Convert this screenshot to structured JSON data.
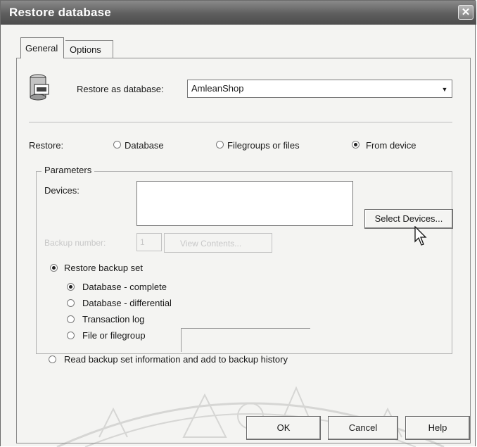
{
  "window": {
    "title": "Restore database",
    "close_glyph": "✕"
  },
  "tabs": [
    {
      "label": "General"
    },
    {
      "label": "Options"
    }
  ],
  "restore_as": {
    "label": "Restore as database:",
    "value": "AmleanShop",
    "arrow": "▼"
  },
  "restore_mode": {
    "label": "Restore:",
    "options": [
      {
        "label": "Database",
        "checked": false
      },
      {
        "label": "Filegroups or files",
        "checked": false
      },
      {
        "label": "From device",
        "checked": true
      }
    ]
  },
  "parameters": {
    "label": "Parameters",
    "devices_label": "Devices:",
    "select_devices_label": "Select Devices...",
    "backup_number_label": "Backup number:",
    "backup_number_value": "1",
    "view_contents_label": "View Contents...",
    "restore_backup_set": {
      "label": "Restore backup set",
      "checked": true
    },
    "backup_types": [
      {
        "label": "Database - complete",
        "checked": true
      },
      {
        "label": "Database - differential",
        "checked": false
      },
      {
        "label": "Transaction log",
        "checked": false
      },
      {
        "label": "File or filegroup",
        "checked": false
      }
    ],
    "read_backup": {
      "label": "Read backup set information and add to backup history",
      "checked": false
    }
  },
  "footer": {
    "ok_label": "OK",
    "cancel_label": "Cancel",
    "help_label": "Help"
  },
  "icons": {
    "database": "database-icon",
    "cursor": "mouse-pointer-icon"
  }
}
